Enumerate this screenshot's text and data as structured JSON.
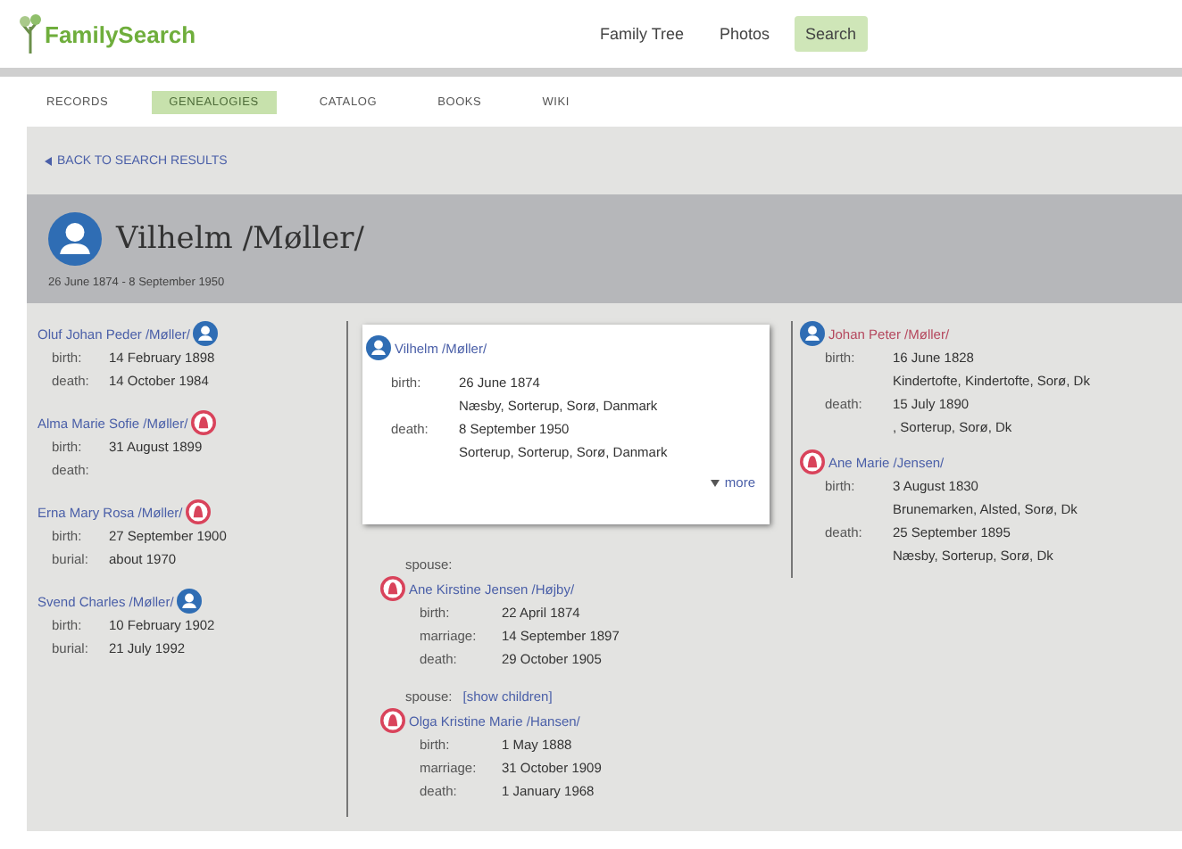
{
  "header": {
    "logo": "FamilySearch",
    "nav": [
      {
        "label": "Family Tree",
        "selected": false
      },
      {
        "label": "Photos",
        "selected": false
      },
      {
        "label": "Search",
        "selected": true
      }
    ]
  },
  "tabs": [
    {
      "label": "RECORDS",
      "selected": false
    },
    {
      "label": "GENEALOGIES",
      "selected": true
    },
    {
      "label": "CATALOG",
      "selected": false
    },
    {
      "label": "BOOKS",
      "selected": false
    },
    {
      "label": "WIKI",
      "selected": false
    }
  ],
  "back_link": "BACK TO SEARCH RESULTS",
  "person": {
    "name": "Vilhelm /Møller/",
    "kind": "male",
    "dates": "26 June 1874 - 8 September 1950"
  },
  "children": [
    {
      "name": "Oluf Johan Peder /Møller/",
      "kind": "male",
      "facts": [
        {
          "label": "birth:",
          "value": "14 February 1898"
        },
        {
          "label": "death:",
          "value": "14 October 1984"
        }
      ]
    },
    {
      "name": "Alma Marie Sofie /Møller/",
      "kind": "female",
      "facts": [
        {
          "label": "birth:",
          "value": "31 August 1899"
        },
        {
          "label": "death:"
        }
      ]
    },
    {
      "name": "Erna Mary Rosa /Møller/",
      "kind": "female",
      "facts": [
        {
          "label": "birth:",
          "value": "27 September 1900"
        },
        {
          "label": "burial:",
          "value": "about 1970"
        }
      ]
    },
    {
      "name": "Svend Charles /Møller/",
      "kind": "male",
      "facts": [
        {
          "label": "birth:",
          "value": "10 February 1902"
        },
        {
          "label": "burial:",
          "value": "21 July 1992"
        }
      ]
    }
  ],
  "focus_card": {
    "name": "Vilhelm /Møller/",
    "kind": "male",
    "facts": [
      {
        "label": "birth:",
        "value": "26 June 1874",
        "place": "Næsby, Sorterup, Sorø, Danmark"
      },
      {
        "label": "death:",
        "value": "8 September 1950",
        "place": "Sorterup, Sorterup, Sorø, Danmark"
      }
    ],
    "more_link": "more"
  },
  "spouses": [
    {
      "label": "spouse:",
      "name": "Ane Kirstine Jensen /Højby/",
      "kind": "female",
      "facts": [
        {
          "label": "birth:",
          "value": "22 April 1874"
        },
        {
          "label": "marriage:",
          "value": "14 September 1897"
        },
        {
          "label": "death:",
          "value": "29 October 1905"
        }
      ]
    },
    {
      "label": "spouse:",
      "show_children_link": "[show children]",
      "name": "Olga Kristine Marie /Hansen/",
      "kind": "female",
      "facts": [
        {
          "label": "birth:",
          "value": "1 May 1888"
        },
        {
          "label": "marriage:",
          "value": "31 October 1909"
        },
        {
          "label": "death:",
          "value": "1 January 1968"
        }
      ]
    }
  ],
  "parents": [
    {
      "name": "Johan Peter /Møller/",
      "kind": "male",
      "color": "#b5485e",
      "facts": [
        {
          "label": "birth:",
          "value": "16 June 1828",
          "place": "Kindertofte, Kindertofte, Sorø, Dk"
        },
        {
          "label": "death:",
          "value": "15 July 1890",
          "place": ", Sorterup, Sorø, Dk"
        }
      ]
    },
    {
      "name": "Ane Marie /Jensen/",
      "kind": "female",
      "color": "#4a5fa8",
      "facts": [
        {
          "label": "birth:",
          "value": "3 August 1830",
          "place": "Brunemarken, Alsted, Sorø, Dk"
        },
        {
          "label": "death:",
          "value": "25 September 1895",
          "place": "Næsby, Sorterup, Sorø, Dk"
        }
      ]
    }
  ]
}
